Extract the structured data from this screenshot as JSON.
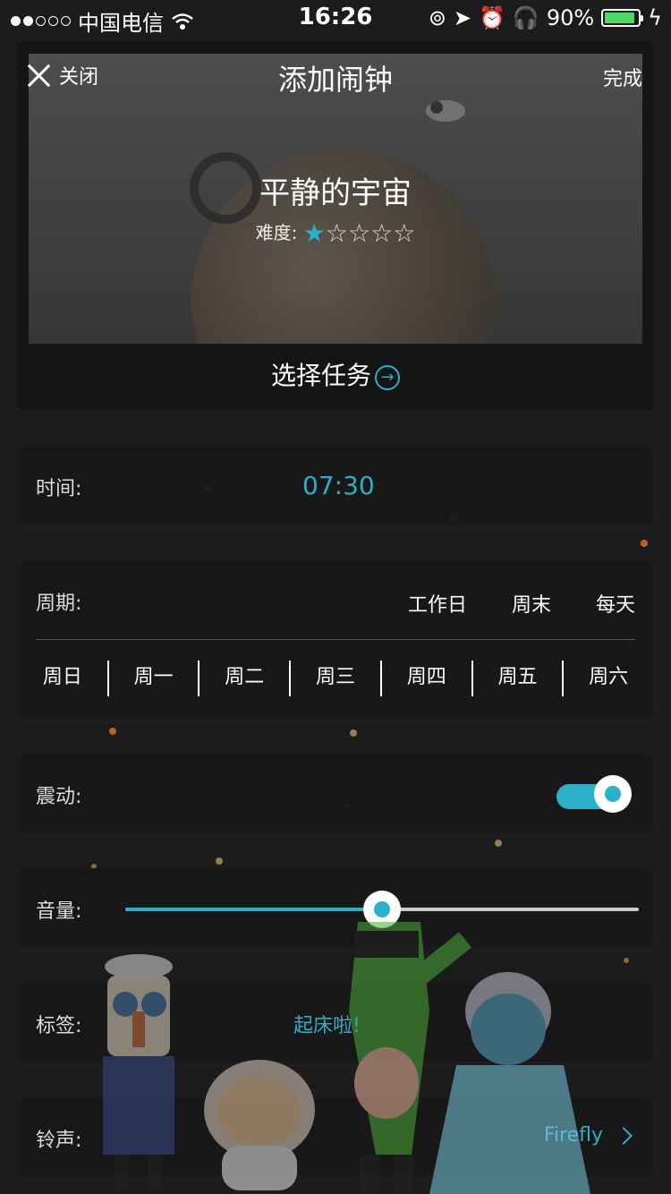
{
  "status_bar": {
    "carrier": "中国电信",
    "time": "16:26",
    "battery": "90%",
    "battery_level": 0.9
  },
  "header": {
    "close_label": "关闭",
    "title": "添加闹钟",
    "done_label": "完成"
  },
  "mission": {
    "name": "平静的宇宙",
    "difficulty_label": "难度:",
    "difficulty_stars": 1,
    "difficulty_max": 5,
    "choose_label": "选择任务"
  },
  "time": {
    "label": "时间:",
    "value": "07:30"
  },
  "period": {
    "label": "周期:",
    "presets": [
      "工作日",
      "周末",
      "每天"
    ],
    "days": [
      "周日",
      "周一",
      "周二",
      "周三",
      "周四",
      "周五",
      "周六"
    ]
  },
  "vibration": {
    "label": "震动:",
    "enabled": true
  },
  "volume": {
    "label": "音量:",
    "level": 0.5
  },
  "tag": {
    "label": "标签:",
    "value": "起床啦!"
  },
  "ringtone": {
    "label": "铃声:",
    "value": "Firefly"
  },
  "colors": {
    "accent": "#2ab0c8",
    "background": "#1c1c1c",
    "card": "#181818"
  }
}
